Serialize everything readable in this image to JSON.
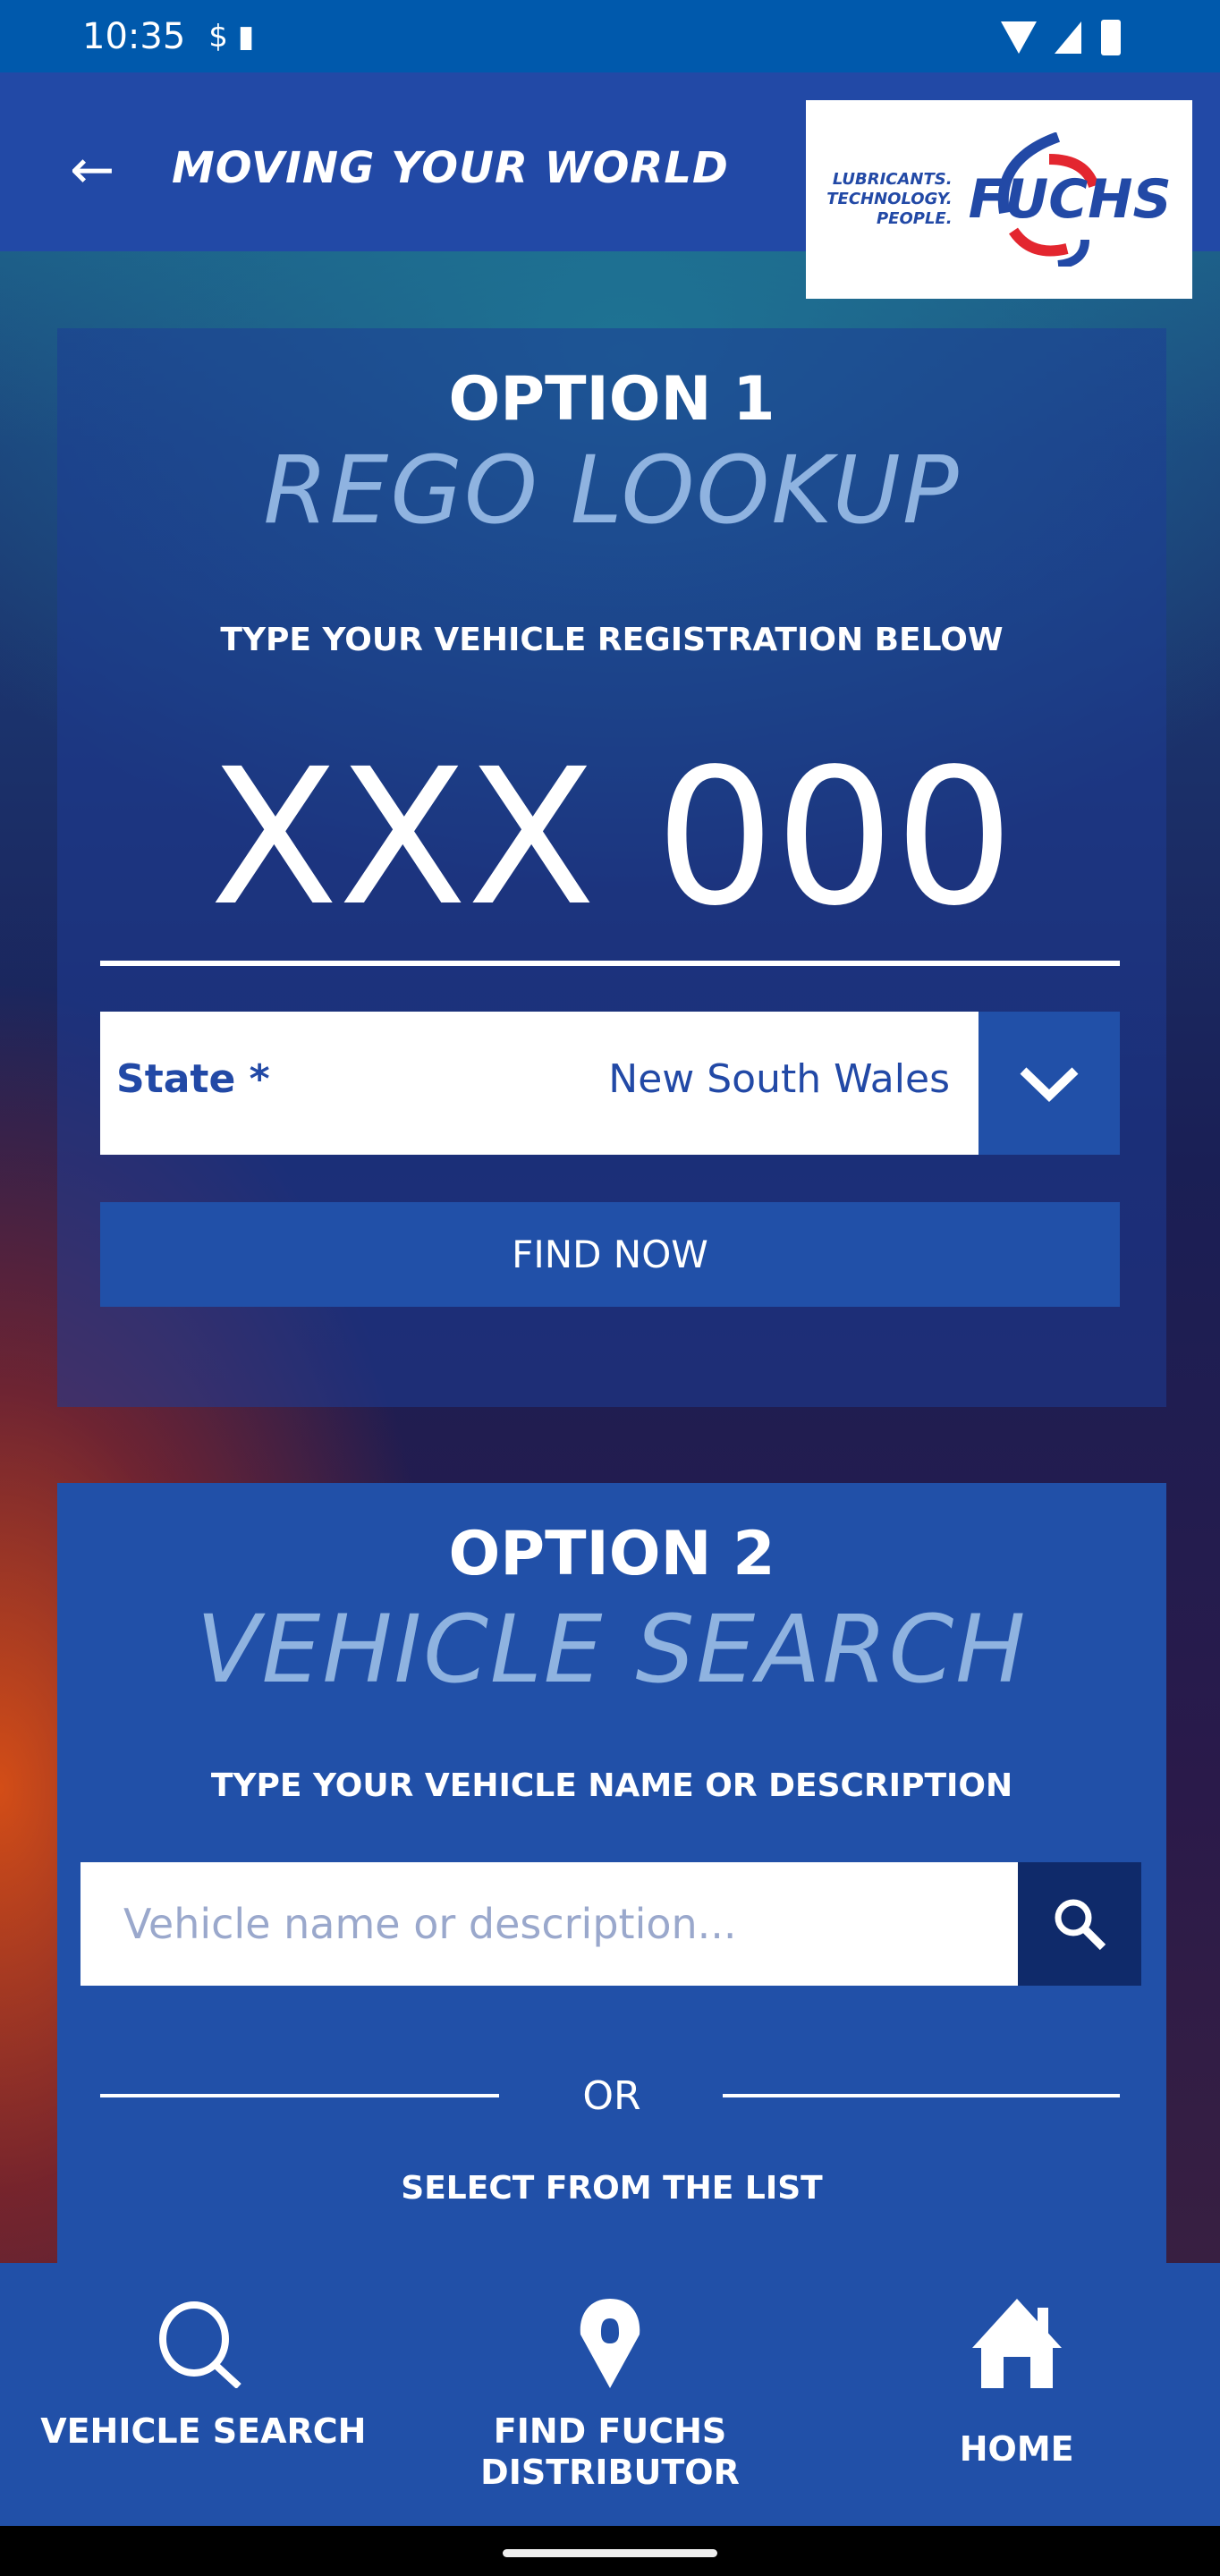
{
  "status_bar": {
    "time": "10:35"
  },
  "header": {
    "tagline": "MOVING YOUR WORLD",
    "logo_tagline": [
      "LUBRICANTS.",
      "TECHNOLOGY.",
      "PEOPLE."
    ],
    "logo_name": "FUCHS"
  },
  "option1": {
    "label": "OPTION 1",
    "title": "REGO LOOKUP",
    "instruction": "TYPE YOUR VEHICLE REGISTRATION BELOW",
    "plate_placeholder": "XXX 000",
    "state_label": "State *",
    "state_value": "New South Wales",
    "find_button": "FIND NOW"
  },
  "option2": {
    "label": "OPTION 2",
    "title": "VEHICLE SEARCH",
    "instruction": "TYPE YOUR VEHICLE NAME OR DESCRIPTION",
    "search_placeholder": "Vehicle name or description...",
    "or": "OR",
    "select_label": "SELECT FROM THE LIST"
  },
  "bottom_nav": [
    {
      "label": "VEHICLE SEARCH",
      "icon": "search-icon"
    },
    {
      "label": "FIND FUCHS DISTRIBUTOR",
      "icon": "location-pin-icon"
    },
    {
      "label": "HOME",
      "icon": "home-icon"
    }
  ],
  "colors": {
    "primary": "#2150a8",
    "header": "#2249a6",
    "status_bar": "#0059ac",
    "logo_red": "#e3262f"
  }
}
